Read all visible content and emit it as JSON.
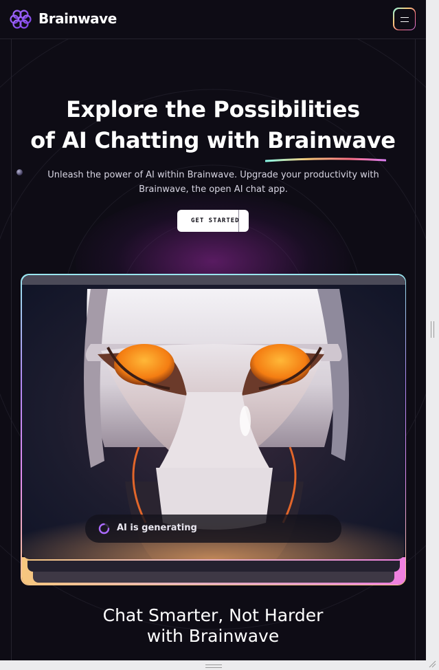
{
  "brand": {
    "name": "Brainwave",
    "logo_icon": "brain-logo-icon"
  },
  "nav": {
    "menu_icon": "hamburger-icon"
  },
  "hero": {
    "title_line1": "Explore the Possibilities",
    "title_line2_prefix": "of AI Chatting with",
    "title_line2_highlight": "Brainwave",
    "subtitle": "Unleash the power of AI within Brainwave. Upgrade your productivity with Brainwave, the open AI chat app.",
    "cta_label": "GET STARTED"
  },
  "preview": {
    "status_text": "AI is generating",
    "status_icon": "loading-spinner-icon"
  },
  "section": {
    "title_line1": "Chat Smarter, Not Harder",
    "title_line2": "with Brainwave"
  },
  "colors": {
    "background": "#0e0c15",
    "accent_gradient": [
      "#89f9e8",
      "#facb7b",
      "#fb7185",
      "#d87cee"
    ],
    "spinner": "#ac6aff"
  }
}
